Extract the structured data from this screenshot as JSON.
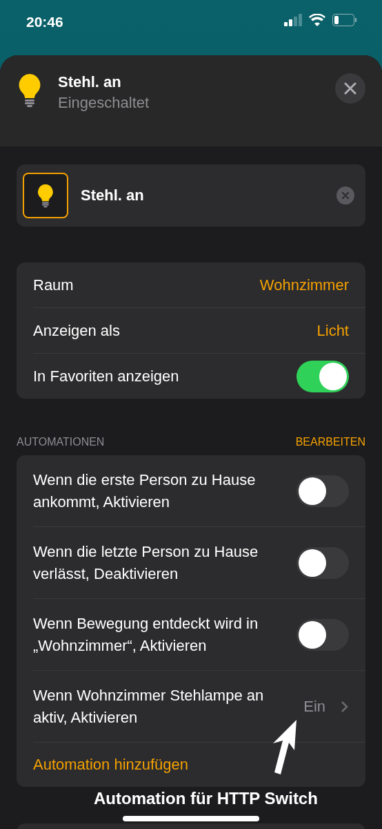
{
  "status_bar": {
    "time": "20:46"
  },
  "header": {
    "title": "Stehl. an",
    "subtitle": "Eingeschaltet"
  },
  "accessory": {
    "name": "Stehl. an"
  },
  "settings": [
    {
      "kind": "value",
      "label": "Raum",
      "value": "Wohnzimmer"
    },
    {
      "kind": "value",
      "label": "Anzeigen als",
      "value": "Licht"
    },
    {
      "kind": "toggle",
      "label": "In Favoriten anzeigen",
      "on": true
    }
  ],
  "automations": {
    "title": "AUTOMATIONEN",
    "edit": "BEARBEITEN",
    "items": [
      {
        "kind": "toggle",
        "label": "Wenn die erste Person zu Hause ankommt, Aktivieren",
        "on": false
      },
      {
        "kind": "toggle",
        "label": "Wenn die letzte Person zu Hause verlässt, Deaktivieren",
        "on": false
      },
      {
        "kind": "toggle",
        "label": "Wenn Bewegung entdeckt wird in „Wohnzimmer“, Aktivieren",
        "on": false
      },
      {
        "kind": "detail",
        "label": "Wenn Wohnzimmer Stehlampe an aktiv, Aktivieren",
        "value": "Ein"
      }
    ],
    "add": "Automation hinzufügen"
  },
  "annotation": {
    "caption": "Automation für HTTP Switch"
  }
}
